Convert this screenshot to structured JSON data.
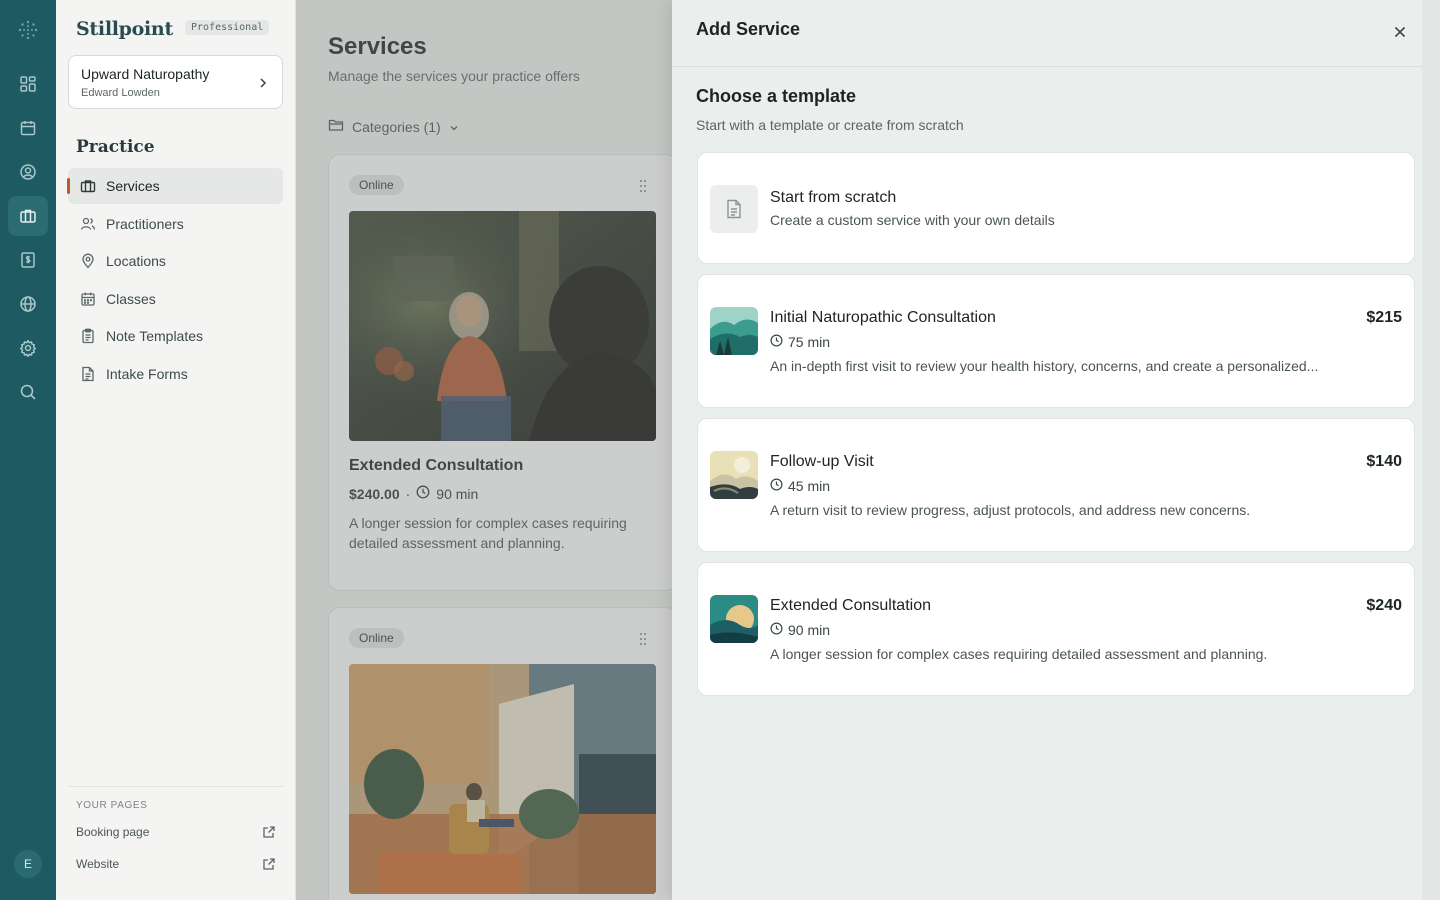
{
  "app": {
    "brand": "Stillpoint",
    "plan_badge": "Professional",
    "user_initial": "E",
    "accent_color": "#1d5a62",
    "active_marker_color": "#c0582e"
  },
  "rail": {
    "icons": [
      "dashboard-icon",
      "calendar-icon",
      "user-circle-icon",
      "briefcase-icon",
      "billing-icon",
      "globe-icon",
      "gear-icon",
      "search-icon"
    ],
    "active": "briefcase-icon"
  },
  "sidebar": {
    "practice_name": "Upward Naturopathy",
    "practice_user": "Edward Lowden",
    "section_title": "Practice",
    "items": [
      {
        "label": "Services",
        "icon": "briefcase-icon",
        "active": true
      },
      {
        "label": "Practitioners",
        "icon": "users-icon",
        "active": false
      },
      {
        "label": "Locations",
        "icon": "map-pin-icon",
        "active": false
      },
      {
        "label": "Classes",
        "icon": "calendar-icon",
        "active": false
      },
      {
        "label": "Note Templates",
        "icon": "clipboard-icon",
        "active": false
      },
      {
        "label": "Intake Forms",
        "icon": "file-text-icon",
        "active": false
      }
    ],
    "pages_label": "YOUR PAGES",
    "pages": [
      {
        "label": "Booking page",
        "icon": "external-link-icon"
      },
      {
        "label": "Website",
        "icon": "external-link-icon"
      }
    ]
  },
  "main": {
    "title": "Services",
    "subtitle": "Manage the services your practice offers",
    "categories_label": "Categories (1)",
    "cards": [
      {
        "badge": "Online",
        "name": "Extended Consultation",
        "price": "$240.00",
        "separator": "·",
        "duration": "90 min",
        "description": "A longer session for complex cases requiring detailed assessment and planning."
      },
      {
        "badge": "Online"
      }
    ]
  },
  "drawer": {
    "title": "Add Service",
    "section_title": "Choose a template",
    "section_subtitle": "Start with a template or create from scratch",
    "scratch": {
      "title": "Start from scratch",
      "subtitle": "Create a custom service with your own details",
      "icon": "document-icon"
    },
    "templates": [
      {
        "name": "Initial Naturopathic Consultation",
        "price": "$215",
        "duration": "75 min",
        "description": "An in-depth first visit to review your health history, concerns, and create a personalized..."
      },
      {
        "name": "Follow-up Visit",
        "price": "$140",
        "duration": "45 min",
        "description": "A return visit to review progress, adjust protocols, and address new concerns."
      },
      {
        "name": "Extended Consultation",
        "price": "$240",
        "duration": "90 min",
        "description": "A longer session for complex cases requiring detailed assessment and planning."
      }
    ]
  }
}
